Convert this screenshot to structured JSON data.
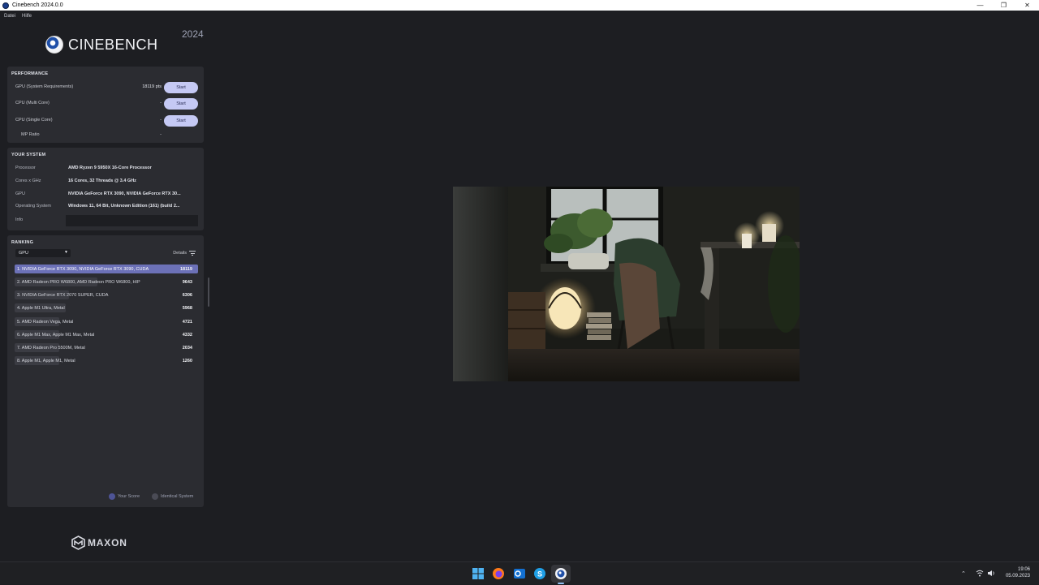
{
  "window": {
    "title": "Cinebench 2024.0.0",
    "controls": {
      "minimize": "—",
      "restore": "❐",
      "close": "✕"
    }
  },
  "menu": {
    "items": [
      "Datei",
      "Hilfe"
    ]
  },
  "brand": {
    "logo_text": "CINEBENCH",
    "version": "2024",
    "footer_logo": "MAXON"
  },
  "performance": {
    "title": "PERFORMANCE",
    "rows": [
      {
        "label": "GPU (System Requirements)",
        "value": "18119 pts",
        "button": "Start"
      },
      {
        "label": "CPU (Multi Core)",
        "value": "-",
        "button": "Start"
      },
      {
        "label": "CPU (Single Core)",
        "value": "-",
        "button": "Start"
      },
      {
        "label": "MP Ratio",
        "value": "-"
      }
    ]
  },
  "system": {
    "title": "YOUR SYSTEM",
    "rows": [
      {
        "label": "Processor",
        "value": "AMD Ryzen 9 5950X 16-Core Processor"
      },
      {
        "label": "Cores x GHz",
        "value": "16 Cores, 32 Threads @ 3.4 GHz"
      },
      {
        "label": "GPU",
        "value": "NVIDIA GeForce RTX 3090, NVIDIA GeForce RTX 30..."
      },
      {
        "label": "Operating System",
        "value": "Windows 11, 64 Bit, Unknown Edition (161) (build 2..."
      },
      {
        "label": "Info",
        "value": ""
      }
    ]
  },
  "ranking": {
    "title": "RANKING",
    "selected": "GPU",
    "details_label": "Details",
    "max_score": 18119,
    "rows": [
      {
        "name": "1. NVIDIA GeForce RTX 3090, NVIDIA GeForce RTX 3090, CUDA",
        "score": "18119",
        "score_value": 18119,
        "highlight": true
      },
      {
        "name": "2. AMD Radeon PRO W6800, AMD Radeon PRO W6800, HIP",
        "score": "9643",
        "score_value": 9643,
        "highlight": false
      },
      {
        "name": "3. NVIDIA GeForce RTX 2070 SUPER, CUDA",
        "score": "6306",
        "score_value": 6306,
        "highlight": false
      },
      {
        "name": "4. Apple M1 Ultra, Metal",
        "score": "5968",
        "score_value": 5968,
        "highlight": false
      },
      {
        "name": "5. AMD Radeon Vega, Metal",
        "score": "4721",
        "score_value": 4721,
        "highlight": false
      },
      {
        "name": "6. Apple M1 Max, Apple M1 Max, Metal",
        "score": "4332",
        "score_value": 4332,
        "highlight": false
      },
      {
        "name": "7. AMD Radeon Pro 5500M, Metal",
        "score": "2034",
        "score_value": 2034,
        "highlight": false
      },
      {
        "name": "8. Apple M1, Apple M1, Metal",
        "score": "1260",
        "score_value": 1260,
        "highlight": false
      }
    ],
    "legend": [
      {
        "label": "Your Score",
        "color": "#4e5496"
      },
      {
        "label": "Identical System",
        "color": "#4a4b55"
      }
    ]
  },
  "colors": {
    "accent": "#6c71b7",
    "button": "#c5c9f4",
    "panel": "#2b2c31",
    "background": "#1d1e22"
  },
  "taskbar": {
    "icons": [
      "windows-start-icon",
      "firefox-icon",
      "outlook-icon",
      "skype-icon",
      "cinebench-icon"
    ],
    "clock_time": "19:06",
    "clock_date": "05.09.2023"
  }
}
